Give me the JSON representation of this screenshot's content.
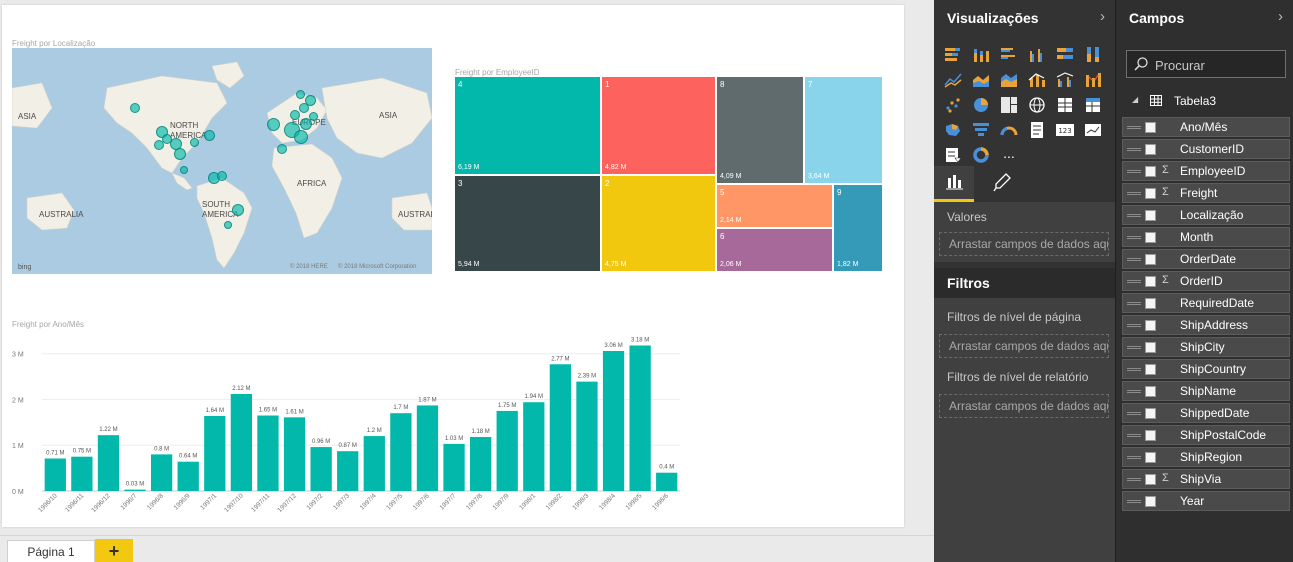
{
  "report": {
    "map": {
      "title": "Freight por Localização",
      "labels": {
        "asia_left": "ASIA",
        "north_america": "NORTH AMERICA",
        "europe": "EUROPE",
        "asia_right": "ASIA",
        "africa": "AFRICA",
        "south_america": "SOUTH AMERICA",
        "australia_left": "AUSTRALIA",
        "australia_right": "AUSTRALIA"
      },
      "bing_logo": "bing",
      "copyright_1": "© 2018 HERE",
      "copyright_2": "© 2018 Microsoft Corporation"
    },
    "treemap": {
      "title": "Freight por EmployeeID",
      "cells": [
        {
          "label": "4",
          "value": "6,19 M",
          "color": "#01b8aa"
        },
        {
          "label": "1",
          "value": "4,82 M",
          "color": "#fd625e"
        },
        {
          "label": "8",
          "value": "4,09 M",
          "color": "#5f6b6d"
        },
        {
          "label": "7",
          "value": "3,64 M",
          "color": "#8ad4eb"
        },
        {
          "label": "3",
          "value": "5,94 M",
          "color": "#374649"
        },
        {
          "label": "2",
          "value": "4,75 M",
          "color": "#f2c80f"
        },
        {
          "label": "5",
          "value": "2,14 M",
          "color": "#fe9666"
        },
        {
          "label": "6",
          "value": "2,06 M",
          "color": "#a66999"
        },
        {
          "label": "9",
          "value": "1,82 M",
          "color": "#3599b8"
        }
      ]
    },
    "barchart": {
      "title": "Freight por Ano/Mês"
    }
  },
  "chart_data": {
    "type": "bar",
    "title": "Freight por Ano/Mês",
    "xlabel": "",
    "ylabel": "",
    "ylim": [
      0,
      3.3
    ],
    "yticks": [
      "0 M",
      "1 M",
      "2 M",
      "3 M"
    ],
    "color": "#01b8aa",
    "categories": [
      "1996/10",
      "1996/11",
      "1996/12",
      "1996/7",
      "1996/8",
      "1996/9",
      "1997/1",
      "1997/10",
      "1997/11",
      "1997/12",
      "1997/2",
      "1997/3",
      "1997/4",
      "1997/5",
      "1997/6",
      "1997/7",
      "1997/8",
      "1997/9",
      "1998/1",
      "1998/2",
      "1998/3",
      "1998/4",
      "1998/5",
      "1998/6"
    ],
    "values": [
      0.71,
      0.75,
      1.22,
      0.03,
      0.8,
      0.64,
      1.64,
      2.12,
      1.65,
      1.61,
      0.96,
      0.87,
      1.2,
      1.7,
      1.87,
      1.03,
      1.18,
      1.75,
      1.94,
      2.77,
      2.39,
      3.06,
      3.18,
      0.4
    ],
    "labels": [
      "0.71 M",
      "0.75 M",
      "1.22 M",
      "0.03 M",
      "0.8 M",
      "0.64 M",
      "1.64 M",
      "2.12 M",
      "1.65 M",
      "1.61 M",
      "0.96 M",
      "0.87 M",
      "1.2 M",
      "1.7 M",
      "1.87 M",
      "1.03 M",
      "1.18 M",
      "1.75 M",
      "1.94 M",
      "2.77 M",
      "2.39 M",
      "3.06 M",
      "3.18 M",
      "0.4 M"
    ]
  },
  "pages": {
    "tab_label": "Página 1",
    "add_label": "+"
  },
  "visualizations": {
    "title": "Visualizações",
    "chevron": "›",
    "more_label": "...",
    "values_label": "Valores",
    "values_drop": "Arrastar campos de dados aqui",
    "filters_title": "Filtros",
    "page_filters_label": "Filtros de nível de página",
    "page_filters_drop": "Arrastar campos de dados aqui",
    "report_filters_label": "Filtros de nível de relatório",
    "report_filters_drop": "Arrastar campos de dados aqui"
  },
  "fields": {
    "title": "Campos",
    "chevron": "›",
    "search_placeholder": "Procurar",
    "table_name": "Tabela3",
    "items": [
      {
        "name": "Ano/Mês",
        "sigma": ""
      },
      {
        "name": "CustomerID",
        "sigma": ""
      },
      {
        "name": "EmployeeID",
        "sigma": "Σ"
      },
      {
        "name": "Freight",
        "sigma": "Σ"
      },
      {
        "name": "Localização",
        "sigma": ""
      },
      {
        "name": "Month",
        "sigma": ""
      },
      {
        "name": "OrderDate",
        "sigma": ""
      },
      {
        "name": "OrderID",
        "sigma": "Σ"
      },
      {
        "name": "RequiredDate",
        "sigma": ""
      },
      {
        "name": "ShipAddress",
        "sigma": ""
      },
      {
        "name": "ShipCity",
        "sigma": ""
      },
      {
        "name": "ShipCountry",
        "sigma": ""
      },
      {
        "name": "ShipName",
        "sigma": ""
      },
      {
        "name": "ShippedDate",
        "sigma": ""
      },
      {
        "name": "ShipPostalCode",
        "sigma": ""
      },
      {
        "name": "ShipRegion",
        "sigma": ""
      },
      {
        "name": "ShipVia",
        "sigma": "Σ"
      },
      {
        "name": "Year",
        "sigma": ""
      }
    ]
  }
}
